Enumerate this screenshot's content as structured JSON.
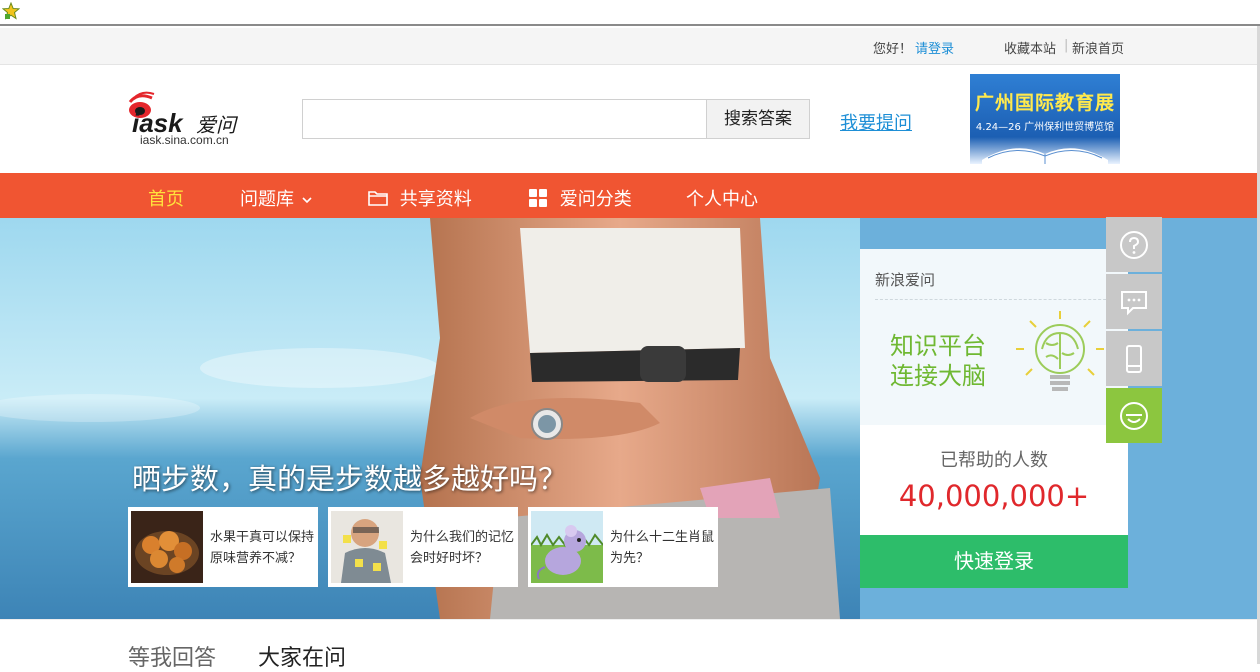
{
  "topbar": {
    "greeting": "您好！",
    "login_link": "请登录",
    "bookmark": "收藏本站",
    "separator": "|",
    "sina_home": "新浪首页"
  },
  "header": {
    "logo_text": "iask爱问",
    "logo_domain": "iask.sina.com.cn",
    "search_placeholder": "",
    "search_button": "搜索答案",
    "ask_link": "我要提问",
    "ad": {
      "title": "广州国际教育展",
      "subtitle": "4.24—26 广州保利世贸博览馆"
    }
  },
  "nav": {
    "items": [
      {
        "label": "首页",
        "active": true
      },
      {
        "label": "问题库",
        "icon": "chevron-down-icon"
      },
      {
        "label": "共享资料",
        "icon": "folder-icon"
      },
      {
        "label": "爱问分类",
        "icon": "grid-icon"
      },
      {
        "label": "个人中心"
      }
    ]
  },
  "hero": {
    "title": "晒步数，真的是步数越多越好吗？",
    "cards": [
      {
        "text": "水果干真可以保持原味营养不减？",
        "thumb": "dried-fruit-image"
      },
      {
        "text": "为什么我们的记忆会时好时坏？",
        "thumb": "forgetful-man-image"
      },
      {
        "text": "为什么十二生肖鼠为先？",
        "thumb": "cartoon-mouse-image"
      }
    ]
  },
  "panel": {
    "title": "新浪爱问",
    "slogan_line1": "知识平台",
    "slogan_line2": "连接大脑",
    "count_label": "已帮助的人数",
    "count_value": "40,000,000+",
    "login_button": "快速登录"
  },
  "side_tools": [
    "question-icon",
    "chat-icon",
    "mobile-icon",
    "smile-icon"
  ],
  "tabs": {
    "waiting": "等我回答",
    "everyone": "大家在问"
  },
  "colors": {
    "nav_bg": "#f05532",
    "nav_active": "#ffe23c",
    "login_green": "#2dbd6a",
    "count_red": "#e0282c",
    "link_blue": "#1e8fd6"
  }
}
